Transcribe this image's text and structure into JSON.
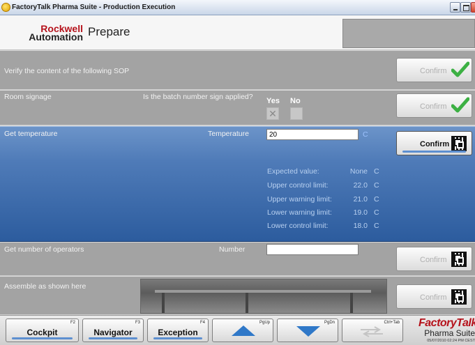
{
  "window": {
    "title": "FactoryTalk Pharma Suite - Production Execution"
  },
  "header": {
    "brand_line1": "Rockwell",
    "brand_line2": "Automation",
    "title": "Prepare"
  },
  "rows": [
    {
      "label": "Verify the content of the following SOP",
      "confirm_label": "Confirm",
      "confirm_icon": "check-icon"
    },
    {
      "label": "Room signage",
      "question": "Is the batch number sign applied?",
      "yes_label": "Yes",
      "no_label": "No",
      "yes_mark": "✕",
      "confirm_label": "Confirm",
      "confirm_icon": "check-icon"
    },
    {
      "label": "Get temperature",
      "field_label": "Temperature",
      "value": "20",
      "unit": "C",
      "confirm_label": "Confirm",
      "confirm_icon": "barcode-icon",
      "limits": [
        {
          "label": "Expected value:",
          "value": "None",
          "unit": "C"
        },
        {
          "label": "Upper control limit:",
          "value": "22.0",
          "unit": "C"
        },
        {
          "label": "Upper warning limit:",
          "value": "21.0",
          "unit": "C"
        },
        {
          "label": "Lower warning limit:",
          "value": "19.0",
          "unit": "C"
        },
        {
          "label": "Lower control limit:",
          "value": "18.0",
          "unit": "C"
        }
      ]
    },
    {
      "label": "Get number of operators",
      "field_label": "Number",
      "value": "",
      "confirm_label": "Confirm",
      "confirm_icon": "barcode-icon"
    },
    {
      "label": "Assemble as shown here",
      "confirm_label": "Confirm",
      "confirm_icon": "barcode-icon"
    }
  ],
  "footer": {
    "cockpit": {
      "label": "Cockpit",
      "key": "F2"
    },
    "navigator": {
      "label": "Navigator",
      "key": "F3"
    },
    "exception": {
      "label": "Exception",
      "key": "F4"
    },
    "page_up": {
      "key": "PgUp"
    },
    "page_down": {
      "key": "PgDn"
    },
    "switch": {
      "key": "Ctrl+Tab"
    },
    "brand_a": "Factory",
    "brand_b": "Talk",
    "brand_line2": "Pharma Suite",
    "timestamp": "05/07/2010 02:24 PM CEST"
  },
  "colors": {
    "active_row": "#2c5c9e",
    "accent_line": "#5d8fd0",
    "check_green": "#3cb043",
    "brand_red": "#b5121b"
  }
}
